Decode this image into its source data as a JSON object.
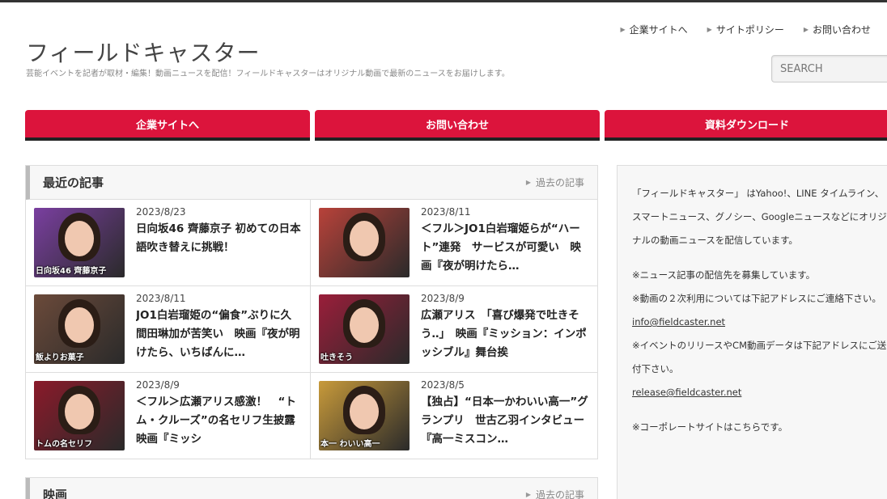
{
  "header": {
    "site_title": "フィールドキャスター",
    "site_description": "芸能イベントを記者が取材・編集！動画ニュースを配信！フィールドキャスターはオリジナル動画で最新のニュースをお届けします。",
    "utility_links": [
      "企業サイトへ",
      "サイトポリシー",
      "お問い合わせ"
    ],
    "search_placeholder": "SEARCH"
  },
  "main_nav": [
    "企業サイトへ",
    "お問い合わせ",
    "資料ダウンロード"
  ],
  "recent": {
    "title": "最近の記事",
    "past_link": "過去の記事",
    "articles": [
      {
        "date": "2023/8/23",
        "title": "日向坂46 齊藤京子 初めての日本語吹き替えに挑戦！",
        "thumb_caption": "日向坂46 齊藤京子",
        "thumb_color": "#7a3fa0"
      },
      {
        "date": "2023/8/11",
        "title": "＜フル＞JO1白岩瑠姫らが“ハート”連発　サービスが可愛い　映画『夜が明けたら…",
        "thumb_caption": "",
        "thumb_color": "#b8423a"
      },
      {
        "date": "2023/8/11",
        "title": "JO1白岩瑠姫の“偏食”ぶりに久間田琳加が苦笑い　映画『夜が明けたら、いちばんに…",
        "thumb_caption": "飯よりお菓子",
        "thumb_color": "#6b4a3a"
      },
      {
        "date": "2023/8/9",
        "title": "広瀬アリス　「喜び爆発で吐きそう‥」　映画『ミッション：インポッシブル』舞台挨",
        "thumb_caption": "吐きそう",
        "thumb_color": "#9a1e3a"
      },
      {
        "date": "2023/8/9",
        "title": "＜フル＞広瀬アリス感激！　“トム・クルーズ”の名セリフ生披露　映画『ミッシ",
        "thumb_caption": "トムの名セリフ",
        "thumb_color": "#8a1a2a"
      },
      {
        "date": "2023/8/5",
        "title": "【独占】“日本一かわいい高一”グランプリ　世古乙羽インタビュー　『高一ミスコン…",
        "thumb_caption": "本一 わいい高一",
        "thumb_color": "#c89a3a"
      }
    ]
  },
  "movie": {
    "title": "映画",
    "past_link": "過去の記事"
  },
  "sidebar": {
    "intro": "「フィールドキャスター」 はYahoo!、LINE タイムライン、スマートニュース、グノシー、Googleニュースなどにオリジナルの動画ニュースを配信しています。",
    "recruit": "※ニュース記事の配信先を募集しています。",
    "secondary_use": "※動画の２次利用については下記アドレスにご連絡下さい。",
    "info_email": "info@fieldcaster.net",
    "release_note": "※イベントのリリースやCM動画データは下記アドレスにご送付下さい。",
    "release_email": "release@fieldcaster.net",
    "corporate_note": "※コーポレートサイトはこちらです。"
  }
}
